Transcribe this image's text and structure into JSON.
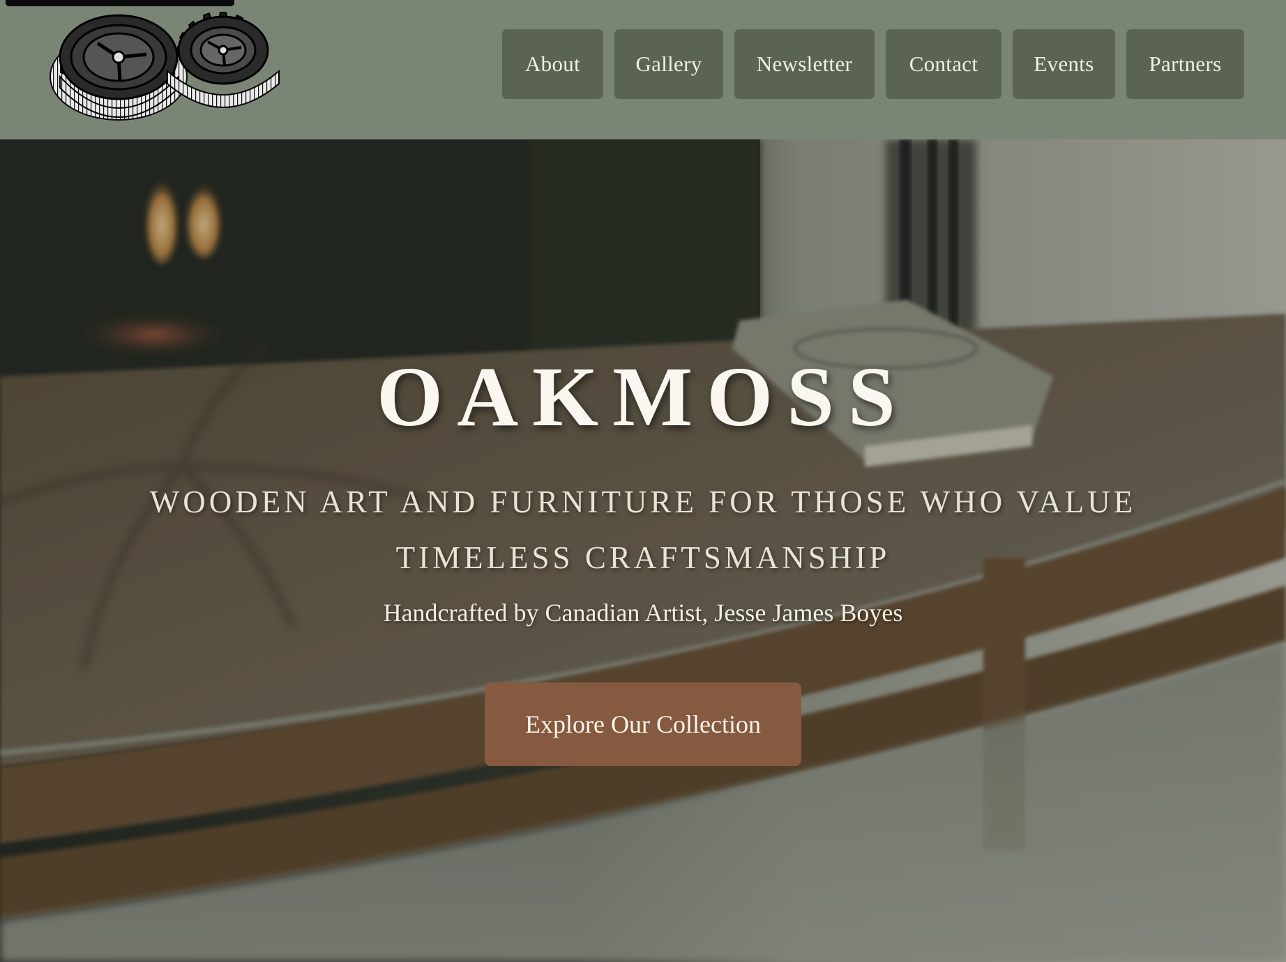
{
  "header": {
    "logo_icon": "interlocking-gears-logo",
    "nav": [
      {
        "label": "About"
      },
      {
        "label": "Gallery"
      },
      {
        "label": "Newsletter"
      },
      {
        "label": "Contact"
      },
      {
        "label": "Events"
      },
      {
        "label": "Partners"
      }
    ]
  },
  "hero": {
    "title": "OAKMOSS",
    "tagline_line1": "Wooden Art and Furniture for Those Who Value",
    "tagline_line2": "Timeless Craftsmanship",
    "byline": "Handcrafted by Canadian Artist, Jesse James Boyes",
    "cta_label": "Explore Our Collection",
    "background": "blurred photo of a carved wooden table with glass top and a book, fireplace in background"
  },
  "colors": {
    "header_bg": "#7b8575",
    "nav_button_bg": "#5b6352",
    "nav_text": "#f2efe6",
    "cta_bg": "#865a40",
    "hero_text": "#faf7f0"
  }
}
